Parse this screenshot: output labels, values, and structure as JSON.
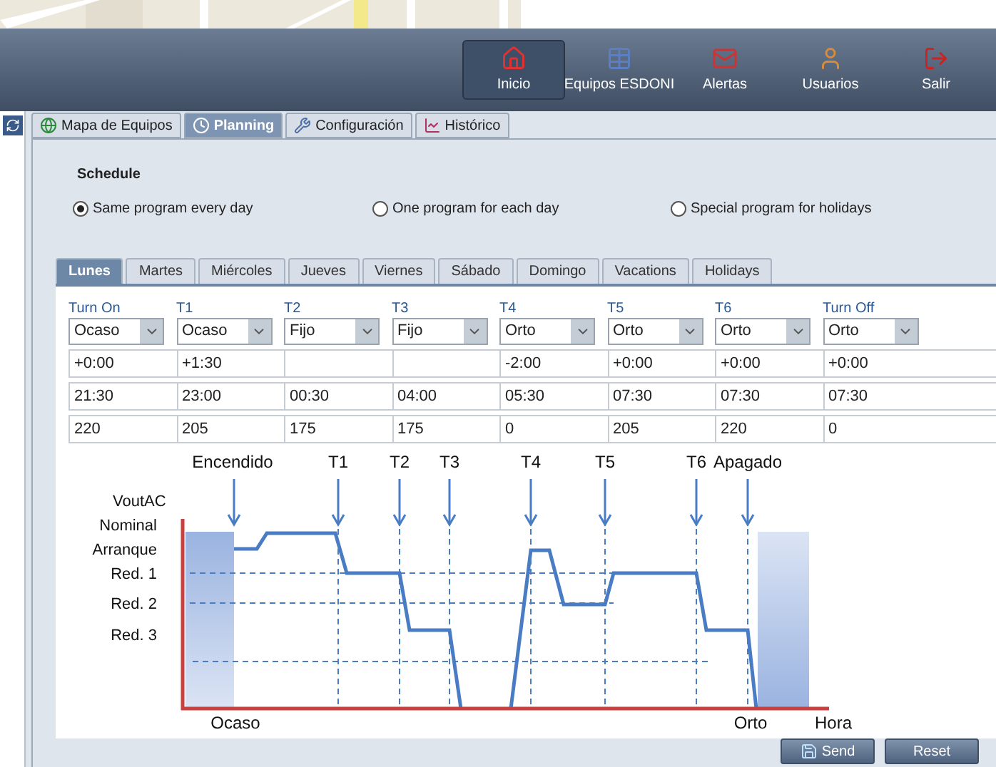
{
  "nav": [
    {
      "label": "Inicio",
      "selected": true
    },
    {
      "label": "Equipos ESDONI",
      "selected": false
    },
    {
      "label": "Alertas",
      "selected": false
    },
    {
      "label": "Usuarios",
      "selected": false
    },
    {
      "label": "Salir",
      "selected": false
    }
  ],
  "main_tabs": [
    {
      "label": "Mapa de Equipos",
      "selected": false
    },
    {
      "label": "Planning",
      "selected": true
    },
    {
      "label": "Configuración",
      "selected": false
    },
    {
      "label": "Histórico",
      "selected": false
    }
  ],
  "schedule": {
    "title": "Schedule",
    "options": [
      {
        "label": "Same program every day",
        "selected": true
      },
      {
        "label": "One program for each day",
        "selected": false
      },
      {
        "label": "Special program for holidays",
        "selected": false
      }
    ]
  },
  "day_tabs": [
    {
      "label": "Lunes",
      "selected": true
    },
    {
      "label": "Martes",
      "selected": false
    },
    {
      "label": "Miércoles",
      "selected": false
    },
    {
      "label": "Jueves",
      "selected": false
    },
    {
      "label": "Viernes",
      "selected": false
    },
    {
      "label": "Sábado",
      "selected": false
    },
    {
      "label": "Domingo",
      "selected": false
    },
    {
      "label": "Vacations",
      "selected": false
    },
    {
      "label": "Holidays",
      "selected": false
    }
  ],
  "table": {
    "columns": [
      {
        "header": "Turn On",
        "mode": "Ocaso"
      },
      {
        "header": "T1",
        "mode": "Ocaso"
      },
      {
        "header": "T2",
        "mode": "Fijo"
      },
      {
        "header": "T3",
        "mode": "Fijo"
      },
      {
        "header": "T4",
        "mode": "Orto"
      },
      {
        "header": "T5",
        "mode": "Orto"
      },
      {
        "header": "T6",
        "mode": "Orto"
      },
      {
        "header": "Turn Off",
        "mode": "Orto"
      }
    ],
    "rows": [
      [
        "+0:00",
        "+1:30",
        null,
        null,
        "-2:00",
        "+0:00",
        "+0:00",
        "+0:00"
      ],
      [
        "21:30",
        "23:00",
        "00:30",
        "04:00",
        "05:30",
        "07:30",
        "07:30",
        "07:30"
      ],
      [
        "220",
        "205",
        "175",
        "175",
        "0",
        "205",
        "220",
        "0"
      ]
    ]
  },
  "diagram": {
    "y_axis_label": "VoutAC",
    "levels": [
      "Nominal",
      "Arranque",
      "Red. 1",
      "Red. 2",
      "Red. 3"
    ],
    "markers": [
      "Encendido",
      "T1",
      "T2",
      "T3",
      "T4",
      "T5",
      "T6",
      "Apagado"
    ],
    "x_labels": [
      "Ocaso",
      "Orto",
      "Hora"
    ]
  },
  "buttons": [
    {
      "label": "Send"
    },
    {
      "label": "Reset"
    }
  ]
}
